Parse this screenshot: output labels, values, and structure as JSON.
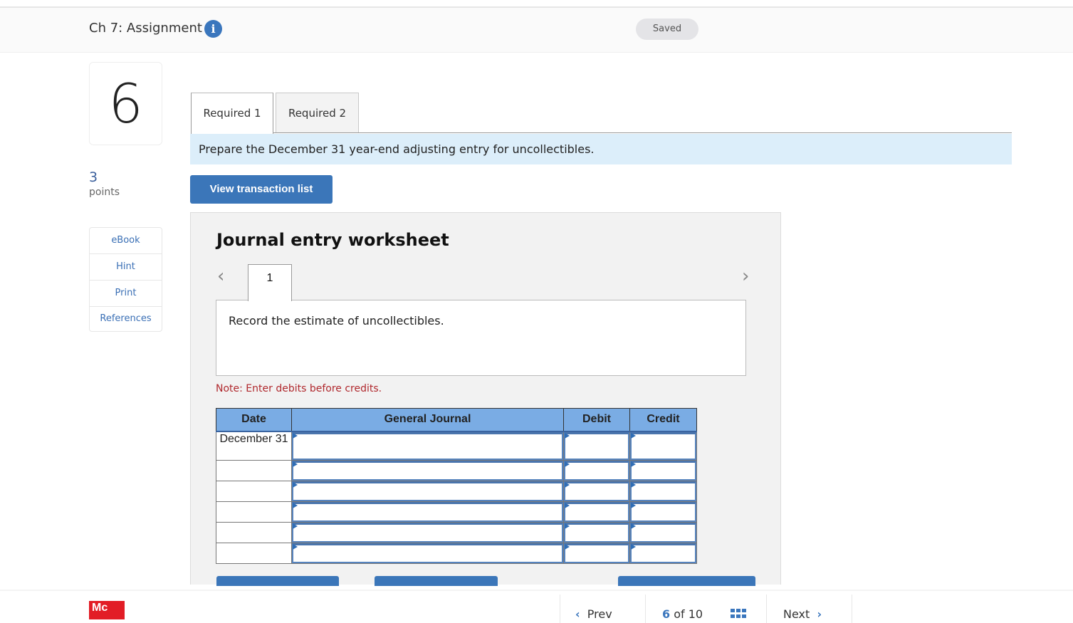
{
  "header": {
    "title": "Ch 7: Assignment",
    "info_icon": "info-circle-icon",
    "status_badge": "Saved"
  },
  "question": {
    "number": "6",
    "points_value": "3",
    "points_label": "points"
  },
  "tools": [
    {
      "label": "eBook"
    },
    {
      "label": "Hint"
    },
    {
      "label": "Print"
    },
    {
      "label": "References"
    }
  ],
  "tabs": [
    {
      "label": "Required 1",
      "active": true
    },
    {
      "label": "Required 2",
      "active": false
    }
  ],
  "instruction": "Prepare the December 31 year-end adjusting entry for uncollectibles.",
  "view_transaction_button": "View transaction list",
  "worksheet": {
    "title": "Journal entry worksheet",
    "prev_icon": "chevron-left-icon",
    "next_icon": "chevron-right-icon",
    "entry_tabs": [
      {
        "label": "1",
        "active": true
      }
    ],
    "entry_description": "Record the estimate of uncollectibles.",
    "note": "Note: Enter debits before credits.",
    "table": {
      "columns": [
        "Date",
        "General Journal",
        "Debit",
        "Credit"
      ],
      "rows": [
        {
          "date": "December 31",
          "general_journal": "",
          "debit": "",
          "credit": ""
        },
        {
          "date": "",
          "general_journal": "",
          "debit": "",
          "credit": ""
        },
        {
          "date": "",
          "general_journal": "",
          "debit": "",
          "credit": ""
        },
        {
          "date": "",
          "general_journal": "",
          "debit": "",
          "credit": ""
        },
        {
          "date": "",
          "general_journal": "",
          "debit": "",
          "credit": ""
        },
        {
          "date": "",
          "general_journal": "",
          "debit": "",
          "credit": ""
        }
      ]
    }
  },
  "footer": {
    "logo_text": "Mc",
    "prev_label": "Prev",
    "current_page": "6",
    "of_label": "of",
    "total_pages": "10",
    "next_label": "Next"
  },
  "colors": {
    "accent": "#3b76b9",
    "table_header": "#7aace4",
    "instruction_bg": "#dceefa",
    "note_text": "#b0282d",
    "logo_red": "#e21d26"
  }
}
